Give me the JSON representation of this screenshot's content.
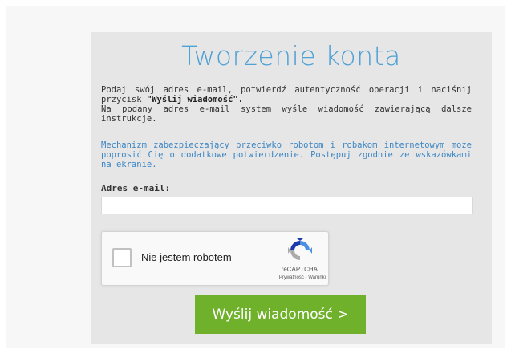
{
  "page": {
    "title": "Tworzenie konta"
  },
  "intro": {
    "line1": "Podaj swój adres e-mail, potwierdź autentyczność operacji i naciśnij przycisk",
    "button_ref": "\"Wyślij wiadomość\".",
    "line2": "Na podany adres e-mail system wyśle wiadomość zawierającą dalsze instrukcje."
  },
  "note": "Mechanizm zabezpieczający przeciwko robotom i robakom internetowym może poprosić Cię o dodatkowe potwierdzenie. Postępuj zgodnie ze wskazówkami na ekranie.",
  "email": {
    "label": "Adres e-mail:",
    "value": ""
  },
  "recaptcha": {
    "label": "Nie jestem robotem",
    "brand": "reCAPTCHA",
    "privacy_link": "Prywatność",
    "separator": " - ",
    "terms_link": "Warunki",
    "logo_icon": "recaptcha-logo-icon"
  },
  "submit": {
    "label": "Wyślij wiadomość >"
  },
  "colors": {
    "title": "#4fa1d6",
    "note": "#3c86c4",
    "button": "#70b12c",
    "panel": "#e6e6e6"
  }
}
